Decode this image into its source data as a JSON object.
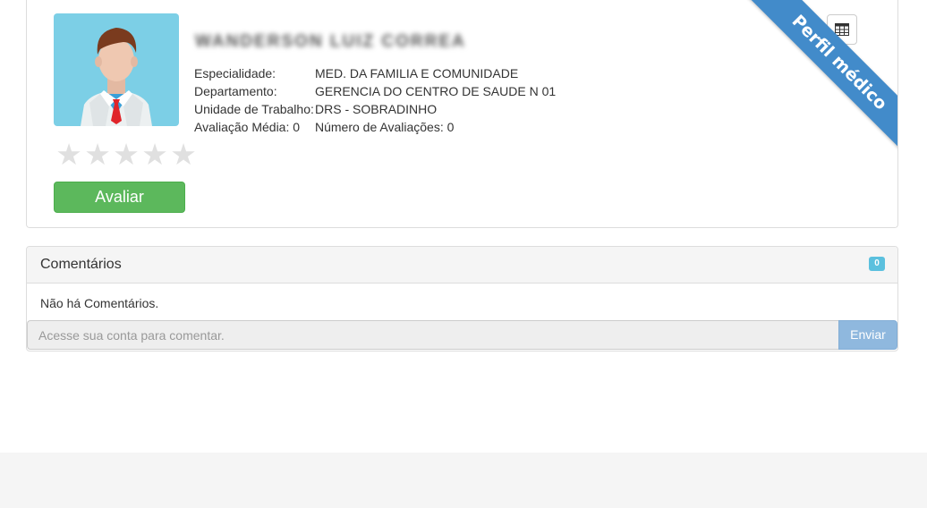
{
  "profile": {
    "name": "WANDERSON LUIZ CORREA",
    "rating_stars": 0,
    "rate_button_label": "Avaliar",
    "ribbon_label": "Perfil médico",
    "info": [
      {
        "label": "Especialidade:",
        "value": "MED. DA FAMILIA E COMUNIDADE"
      },
      {
        "label": "Departamento:",
        "value": "GERENCIA DO CENTRO DE SAUDE N 01"
      },
      {
        "label": "Unidade de Trabalho:",
        "value": "DRS - SOBRADINHO"
      },
      {
        "label": "Avaliação Média: 0",
        "value": "Número de Avaliações: 0"
      }
    ],
    "icons": {
      "calendar": "table-grid-icon",
      "star": "star-icon"
    }
  },
  "comments": {
    "title": "Comentários",
    "count": "0",
    "empty_text": "Não há Comentários.",
    "input_placeholder": "Acesse sua conta para comentar.",
    "send_label": "Enviar"
  },
  "colors": {
    "rate_button": "#5cb85c",
    "ribbon": "#428bca",
    "badge": "#5bc0de",
    "send_button": "#8fb8de",
    "avatar_bg": "#7ccfe6"
  }
}
